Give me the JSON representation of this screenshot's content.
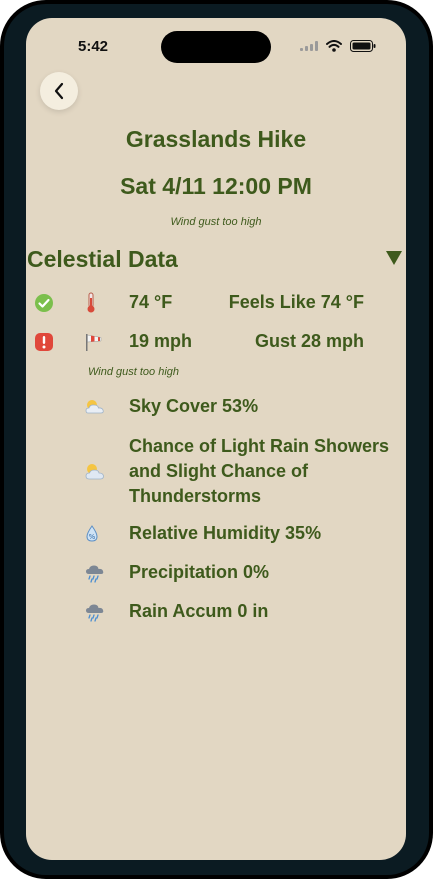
{
  "status_bar": {
    "time": "5:42"
  },
  "header": {
    "back_icon": "chevron-left-icon",
    "title": "Grasslands Hike",
    "datetime": "Sat 4/11 12:00 PM",
    "warning": "Wind gust too high"
  },
  "section": {
    "title": "Celestial Data",
    "toggle_icon": "triangle-down-icon"
  },
  "rows": {
    "temperature": {
      "status_icon": "check-circle-icon",
      "icon": "thermometer-icon",
      "value": "74 °F",
      "secondary": "Feels Like 74 °F"
    },
    "wind": {
      "status_icon": "exclamation-icon",
      "icon": "windsock-icon",
      "value": "19 mph",
      "secondary": "Gust 28 mph",
      "note": "Wind gust too high"
    },
    "sky": {
      "icon": "sun-behind-cloud-icon",
      "value": "Sky Cover 53%"
    },
    "forecast": {
      "icon": "sun-behind-cloud-icon",
      "value": "Chance of Light Rain Showers and Slight Chance of Thunderstorms"
    },
    "humidity": {
      "icon": "droplet-percent-icon",
      "value": "Relative Humidity 35%"
    },
    "precipitation": {
      "icon": "rain-cloud-icon",
      "value": "Precipitation 0%"
    },
    "rain_accum": {
      "icon": "rain-cloud-icon",
      "value": "Rain Accum 0 in"
    }
  },
  "colors": {
    "background": "#e2d7c3",
    "text": "#3e5a1c",
    "check": "#7bbf4c",
    "alert": "#e0473a"
  }
}
